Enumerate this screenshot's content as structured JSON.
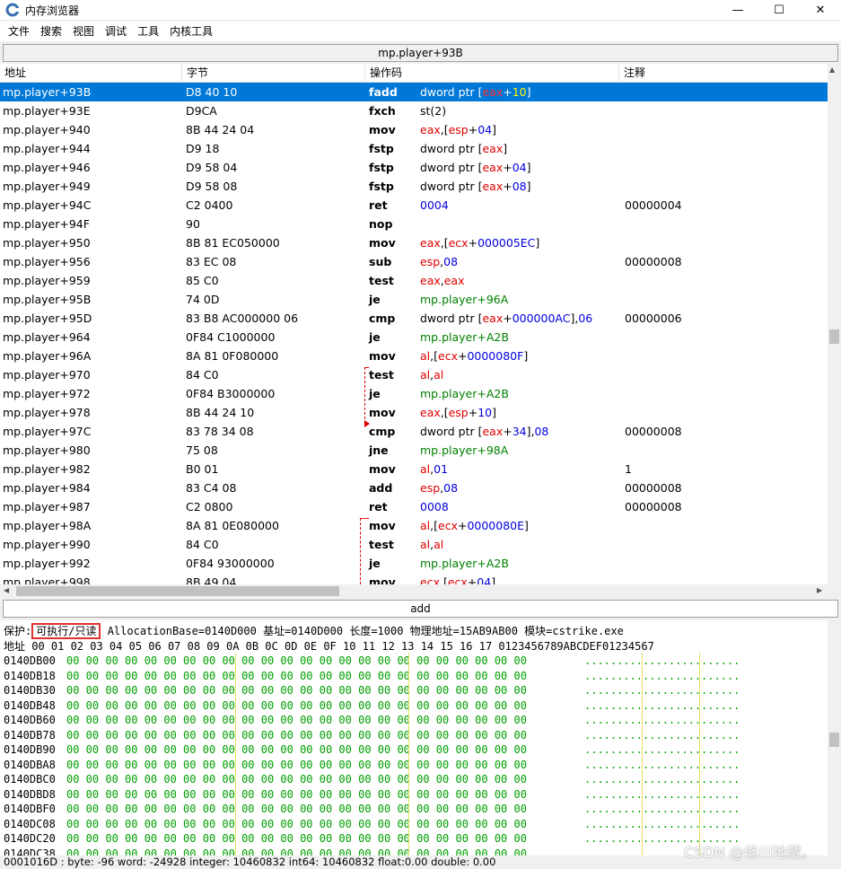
{
  "window": {
    "title": "内存浏览器",
    "minimize": "—",
    "maximize": "☐",
    "close": "✕"
  },
  "menu": [
    "文件",
    "搜索",
    "视图",
    "调试",
    "工具",
    "内核工具"
  ],
  "address_bar": "mp.player+93B",
  "columns": [
    "地址",
    "字节",
    "操作码",
    "注释"
  ],
  "rows": [
    {
      "addr": "mp.player+93B",
      "bytes": "D8 40 10",
      "op": "fadd",
      "args": [
        [
          "k",
          "dword ptr ["
        ],
        [
          "r",
          "eax"
        ],
        [
          "k",
          "+"
        ],
        [
          "g",
          "10"
        ],
        [
          "k",
          "]"
        ]
      ],
      "note": "",
      "selected": true
    },
    {
      "addr": "mp.player+93E",
      "bytes": "D9CA",
      "op": "fxch",
      "args": [
        [
          "k",
          "st(2)"
        ]
      ],
      "note": ""
    },
    {
      "addr": "mp.player+940",
      "bytes": "8B 44 24 04",
      "op": "mov",
      "args": [
        [
          "r",
          "eax"
        ],
        [
          "k",
          ",["
        ],
        [
          "r",
          "esp"
        ],
        [
          "k",
          "+"
        ],
        [
          "b",
          "04"
        ],
        [
          "k",
          "]"
        ]
      ],
      "note": ""
    },
    {
      "addr": "mp.player+944",
      "bytes": "D9 18",
      "op": "fstp",
      "args": [
        [
          "k",
          "dword ptr ["
        ],
        [
          "r",
          "eax"
        ],
        [
          "k",
          "]"
        ]
      ],
      "note": ""
    },
    {
      "addr": "mp.player+946",
      "bytes": "D9 58 04",
      "op": "fstp",
      "args": [
        [
          "k",
          "dword ptr ["
        ],
        [
          "r",
          "eax"
        ],
        [
          "k",
          "+"
        ],
        [
          "b",
          "04"
        ],
        [
          "k",
          "]"
        ]
      ],
      "note": ""
    },
    {
      "addr": "mp.player+949",
      "bytes": "D9 58 08",
      "op": "fstp",
      "args": [
        [
          "k",
          "dword ptr ["
        ],
        [
          "r",
          "eax"
        ],
        [
          "k",
          "+"
        ],
        [
          "b",
          "08"
        ],
        [
          "k",
          "]"
        ]
      ],
      "note": ""
    },
    {
      "addr": "mp.player+94C",
      "bytes": "C2 0400",
      "op": "ret",
      "args": [
        [
          "b",
          "0004"
        ]
      ],
      "note": "00000004"
    },
    {
      "addr": "mp.player+94F",
      "bytes": "90",
      "op": "nop",
      "args": [],
      "note": ""
    },
    {
      "addr": "mp.player+950",
      "bytes": "8B 81 EC050000",
      "op": "mov",
      "args": [
        [
          "r",
          "eax"
        ],
        [
          "k",
          ",["
        ],
        [
          "r",
          "ecx"
        ],
        [
          "k",
          "+"
        ],
        [
          "b",
          "000005EC"
        ],
        [
          "k",
          "]"
        ]
      ],
      "note": ""
    },
    {
      "addr": "mp.player+956",
      "bytes": "83 EC 08",
      "op": "sub",
      "args": [
        [
          "r",
          "esp"
        ],
        [
          "k",
          ","
        ],
        [
          "b",
          "08"
        ]
      ],
      "note": "00000008"
    },
    {
      "addr": "mp.player+959",
      "bytes": "85 C0",
      "op": "test",
      "args": [
        [
          "r",
          "eax"
        ],
        [
          "k",
          ","
        ],
        [
          "r",
          "eax"
        ]
      ],
      "note": ""
    },
    {
      "addr": "mp.player+95B",
      "bytes": "74 0D",
      "op": "je",
      "args": [
        [
          "g",
          "mp.player+96A"
        ]
      ],
      "note": ""
    },
    {
      "addr": "mp.player+95D",
      "bytes": "83 B8 AC000000 06",
      "op": "cmp",
      "args": [
        [
          "k",
          "dword ptr ["
        ],
        [
          "r",
          "eax"
        ],
        [
          "k",
          "+"
        ],
        [
          "b",
          "000000AC"
        ],
        [
          "k",
          "],"
        ],
        [
          "b",
          "06"
        ]
      ],
      "note": "00000006"
    },
    {
      "addr": "mp.player+964",
      "bytes": "0F84 C1000000",
      "op": "je",
      "args": [
        [
          "g",
          "mp.player+A2B"
        ]
      ],
      "note": ""
    },
    {
      "addr": "mp.player+96A",
      "bytes": "8A 81 0F080000",
      "op": "mov",
      "args": [
        [
          "r",
          "al"
        ],
        [
          "k",
          ",["
        ],
        [
          "r",
          "ecx"
        ],
        [
          "k",
          "+"
        ],
        [
          "b",
          "0000080F"
        ],
        [
          "k",
          "]"
        ]
      ],
      "note": ""
    },
    {
      "addr": "mp.player+970",
      "bytes": "84 C0",
      "op": "test",
      "args": [
        [
          "r",
          "al"
        ],
        [
          "k",
          ","
        ],
        [
          "r",
          "al"
        ]
      ],
      "note": ""
    },
    {
      "addr": "mp.player+972",
      "bytes": "0F84 B3000000",
      "op": "je",
      "args": [
        [
          "g",
          "mp.player+A2B"
        ]
      ],
      "note": ""
    },
    {
      "addr": "mp.player+978",
      "bytes": "8B 44 24 10",
      "op": "mov",
      "args": [
        [
          "r",
          "eax"
        ],
        [
          "k",
          ",["
        ],
        [
          "r",
          "esp"
        ],
        [
          "k",
          "+"
        ],
        [
          "b",
          "10"
        ],
        [
          "k",
          "]"
        ]
      ],
      "note": ""
    },
    {
      "addr": "mp.player+97C",
      "bytes": "83 78 34 08",
      "op": "cmp",
      "args": [
        [
          "k",
          "dword ptr ["
        ],
        [
          "r",
          "eax"
        ],
        [
          "k",
          "+"
        ],
        [
          "b",
          "34"
        ],
        [
          "k",
          "],"
        ],
        [
          "b",
          "08"
        ]
      ],
      "note": "00000008"
    },
    {
      "addr": "mp.player+980",
      "bytes": "75 08",
      "op": "jne",
      "args": [
        [
          "g",
          "mp.player+98A"
        ]
      ],
      "note": ""
    },
    {
      "addr": "mp.player+982",
      "bytes": "B0 01",
      "op": "mov",
      "args": [
        [
          "r",
          "al"
        ],
        [
          "k",
          ","
        ],
        [
          "b",
          "01"
        ]
      ],
      "note": "1"
    },
    {
      "addr": "mp.player+984",
      "bytes": "83 C4 08",
      "op": "add",
      "args": [
        [
          "r",
          "esp"
        ],
        [
          "k",
          ","
        ],
        [
          "b",
          "08"
        ]
      ],
      "note": "00000008"
    },
    {
      "addr": "mp.player+987",
      "bytes": "C2 0800",
      "op": "ret",
      "args": [
        [
          "b",
          "0008"
        ]
      ],
      "note": "00000008"
    },
    {
      "addr": "mp.player+98A",
      "bytes": "8A 81 0E080000",
      "op": "mov",
      "args": [
        [
          "r",
          "al"
        ],
        [
          "k",
          ",["
        ],
        [
          "r",
          "ecx"
        ],
        [
          "k",
          "+"
        ],
        [
          "b",
          "0000080E"
        ],
        [
          "k",
          "]"
        ]
      ],
      "note": ""
    },
    {
      "addr": "mp.player+990",
      "bytes": "84 C0",
      "op": "test",
      "args": [
        [
          "r",
          "al"
        ],
        [
          "k",
          ","
        ],
        [
          "r",
          "al"
        ]
      ],
      "note": ""
    },
    {
      "addr": "mp.player+992",
      "bytes": "0F84 93000000",
      "op": "je",
      "args": [
        [
          "g",
          "mp.player+A2B"
        ]
      ],
      "note": ""
    },
    {
      "addr": "mp.player+998",
      "bytes": "8B 49 04",
      "op": "mov",
      "args": [
        [
          "r",
          "ecx"
        ],
        [
          "k",
          ",["
        ],
        [
          "r",
          "ecx"
        ],
        [
          "k",
          "+"
        ],
        [
          "b",
          "04"
        ],
        [
          "k",
          "]"
        ]
      ],
      "note": ""
    }
  ],
  "instruction_bar": "add",
  "protect": {
    "label": "保护:",
    "value": "可执行/只读",
    "rest": " AllocationBase=0140D000 基址=0140D000 长度=1000 物理地址=15AB9AB00 模块=cstrike.exe"
  },
  "hex_header": "地址      00 01 02 03 04 05 06 07 08 09 0A 0B 0C 0D 0E 0F 10 11 12 13 14 15 16 17 0123456789ABCDEF01234567",
  "hex_rows": [
    {
      "addr": "0140DB00",
      "bytes": "00 00 00 00 00 00 00 00 00 00 00 00 00 00 00 00 00 00 00 00 00 00 00 00",
      "ascii": "........................"
    },
    {
      "addr": "0140DB18",
      "bytes": "00 00 00 00 00 00 00 00 00 00 00 00 00 00 00 00 00 00 00 00 00 00 00 00",
      "ascii": "........................"
    },
    {
      "addr": "0140DB30",
      "bytes": "00 00 00 00 00 00 00 00 00 00 00 00 00 00 00 00 00 00 00 00 00 00 00 00",
      "ascii": "........................"
    },
    {
      "addr": "0140DB48",
      "bytes": "00 00 00 00 00 00 00 00 00 00 00 00 00 00 00 00 00 00 00 00 00 00 00 00",
      "ascii": "........................"
    },
    {
      "addr": "0140DB60",
      "bytes": "00 00 00 00 00 00 00 00 00 00 00 00 00 00 00 00 00 00 00 00 00 00 00 00",
      "ascii": "........................"
    },
    {
      "addr": "0140DB78",
      "bytes": "00 00 00 00 00 00 00 00 00 00 00 00 00 00 00 00 00 00 00 00 00 00 00 00",
      "ascii": "........................"
    },
    {
      "addr": "0140DB90",
      "bytes": "00 00 00 00 00 00 00 00 00 00 00 00 00 00 00 00 00 00 00 00 00 00 00 00",
      "ascii": "........................"
    },
    {
      "addr": "0140DBA8",
      "bytes": "00 00 00 00 00 00 00 00 00 00 00 00 00 00 00 00 00 00 00 00 00 00 00 00",
      "ascii": "........................"
    },
    {
      "addr": "0140DBC0",
      "bytes": "00 00 00 00 00 00 00 00 00 00 00 00 00 00 00 00 00 00 00 00 00 00 00 00",
      "ascii": "........................"
    },
    {
      "addr": "0140DBD8",
      "bytes": "00 00 00 00 00 00 00 00 00 00 00 00 00 00 00 00 00 00 00 00 00 00 00 00",
      "ascii": "........................"
    },
    {
      "addr": "0140DBF0",
      "bytes": "00 00 00 00 00 00 00 00 00 00 00 00 00 00 00 00 00 00 00 00 00 00 00 00",
      "ascii": "........................"
    },
    {
      "addr": "0140DC08",
      "bytes": "00 00 00 00 00 00 00 00 00 00 00 00 00 00 00 00 00 00 00 00 00 00 00 00",
      "ascii": "........................"
    },
    {
      "addr": "0140DC20",
      "bytes": "00 00 00 00 00 00 00 00 00 00 00 00 00 00 00 00 00 00 00 00 00 00 00 00",
      "ascii": "........................"
    },
    {
      "addr": "0140DC38",
      "bytes": "00 00 00 00 00 00 00 00 00 00 00 00 00 00 00 00 00 00 00 00 00 00 00 00",
      "ascii": "........................"
    }
  ],
  "status": "0001016D : byte: -96 word: -24928 integer: 10460832 int64: 10460832 float:0.00 double: 0.00",
  "watermark": "CSDN @修川地藏。",
  "colors": {
    "selected": "#0078d7",
    "register": "#e00000",
    "number": "#0000e0",
    "label": "#008000",
    "hex": "#00a000",
    "highlight_box": "#e03030"
  }
}
